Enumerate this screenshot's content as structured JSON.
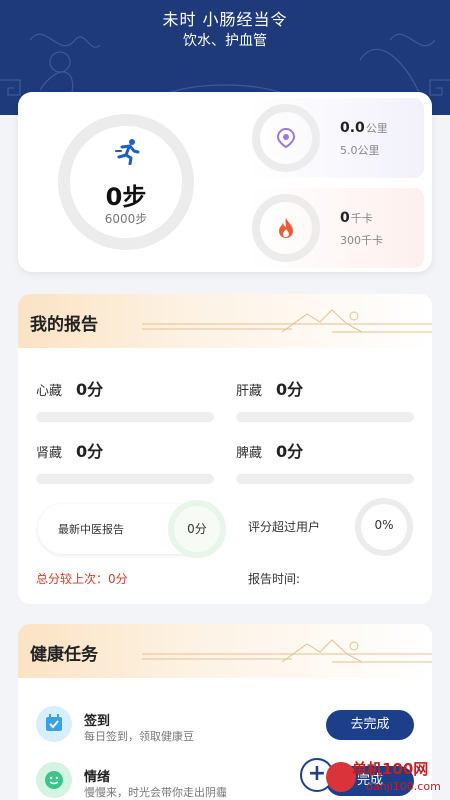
{
  "header": {
    "title": "未时  小肠经当令",
    "subtitle": "饮水、护血管",
    "bg_color": "#1e3a7a"
  },
  "steps": {
    "value": "0步",
    "goal": "6000步",
    "icon": "runner-icon",
    "accent": "#1d5fc4",
    "progress": 0
  },
  "distance": {
    "value": "0.0",
    "unit": "公里",
    "target": "5.0公里",
    "icon": "location-pin-icon",
    "progress": 0
  },
  "calories": {
    "value": "0",
    "unit": "千卡",
    "target": "300千卡",
    "icon": "flame-icon",
    "progress": 0
  },
  "report": {
    "title": "我的报告",
    "organs": [
      {
        "label": "心藏",
        "value": "0分"
      },
      {
        "label": "肝藏",
        "value": "0分"
      },
      {
        "label": "肾藏",
        "value": "0分"
      },
      {
        "label": "脾藏",
        "value": "0分"
      }
    ],
    "tcm_label": "最新中医报告",
    "tcm_score": "0分",
    "surpass_label": "评分超过用户",
    "surpass_value": "0%",
    "compare_label": "总分较上次：0分",
    "report_time_label": "报告时间:"
  },
  "tasks": {
    "title": "健康任务",
    "items": [
      {
        "title": "签到",
        "desc": "每日签到，领取健康豆",
        "button": "去完成",
        "icon": "calendar-check-icon"
      },
      {
        "title": "情绪",
        "desc": "慢慢来，时光会带你走出阴霾",
        "button": "完成",
        "icon": "smile-face-icon"
      }
    ]
  },
  "watermark": {
    "text": "单机100网",
    "url": "danji100.com"
  }
}
